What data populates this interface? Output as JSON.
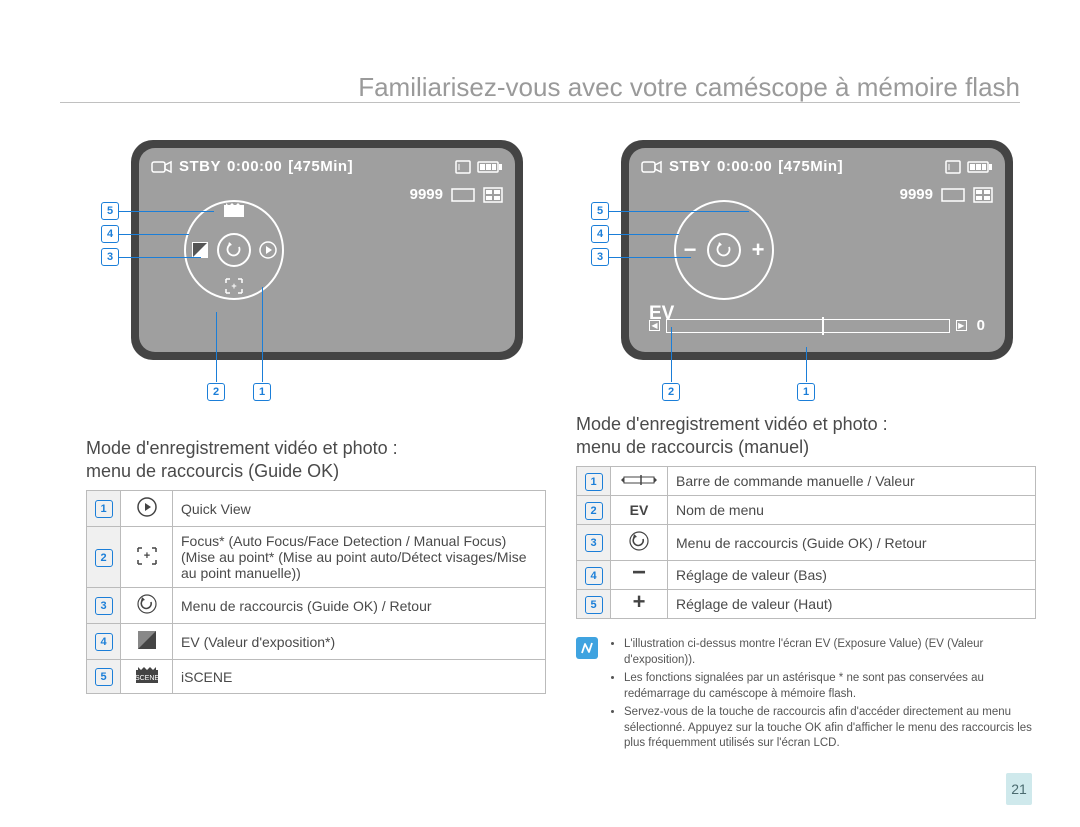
{
  "page": {
    "title": "Familiarisez-vous avec votre caméscope à mémoire flash",
    "number": "21"
  },
  "screen": {
    "status": "STBY",
    "time": "0:00:00",
    "remaining": "[475Min]",
    "photo_count": "9999",
    "ev_label": "EV",
    "ev_value": "0"
  },
  "left": {
    "heading": "Mode d'enregistrement vidéo et photo :\nmenu de raccourcis (Guide OK)",
    "callouts": [
      "5",
      "4",
      "3",
      "2",
      "1"
    ],
    "rows": [
      {
        "num": "1",
        "icon": "play-icon",
        "text": "Quick View"
      },
      {
        "num": "2",
        "icon": "focus-icon",
        "text": "Focus* (Auto Focus/Face Detection / Manual Focus) (Mise au point* (Mise au point auto/Détect visages/Mise au point manuelle))"
      },
      {
        "num": "3",
        "icon": "return-icon",
        "text": "Menu de raccourcis (Guide OK) / Retour"
      },
      {
        "num": "4",
        "icon": "ev-icon",
        "text": "EV (Valeur d'exposition*)"
      },
      {
        "num": "5",
        "icon": "scene-icon",
        "text": "iSCENE"
      }
    ]
  },
  "right": {
    "heading": "Mode d'enregistrement vidéo et photo :\nmenu de raccourcis (manuel)",
    "callouts": [
      "5",
      "4",
      "3",
      "2",
      "1"
    ],
    "rows": [
      {
        "num": "1",
        "icon": "bar-icon",
        "text": "Barre de commande manuelle / Valeur"
      },
      {
        "num": "2",
        "icon": "ev-text-icon",
        "text": "Nom de menu"
      },
      {
        "num": "3",
        "icon": "return-icon",
        "text": "Menu de raccourcis (Guide OK) / Retour"
      },
      {
        "num": "4",
        "icon": "minus-icon",
        "text": "Réglage de valeur (Bas)"
      },
      {
        "num": "5",
        "icon": "plus-icon",
        "text": "Réglage de valeur (Haut)"
      }
    ],
    "notes": [
      "L'illustration ci-dessus montre l'écran EV (Exposure Value) (EV (Valeur d'exposition)).",
      "Les fonctions signalées par un astérisque * ne sont pas conservées au redémarrage du caméscope à mémoire flash.",
      "Servez-vous de la touche de raccourcis afin d'accéder directement au menu sélectionné. Appuyez sur la touche OK afin d'afficher le menu des raccourcis les plus fréquemment utilisés sur l'écran LCD."
    ]
  }
}
